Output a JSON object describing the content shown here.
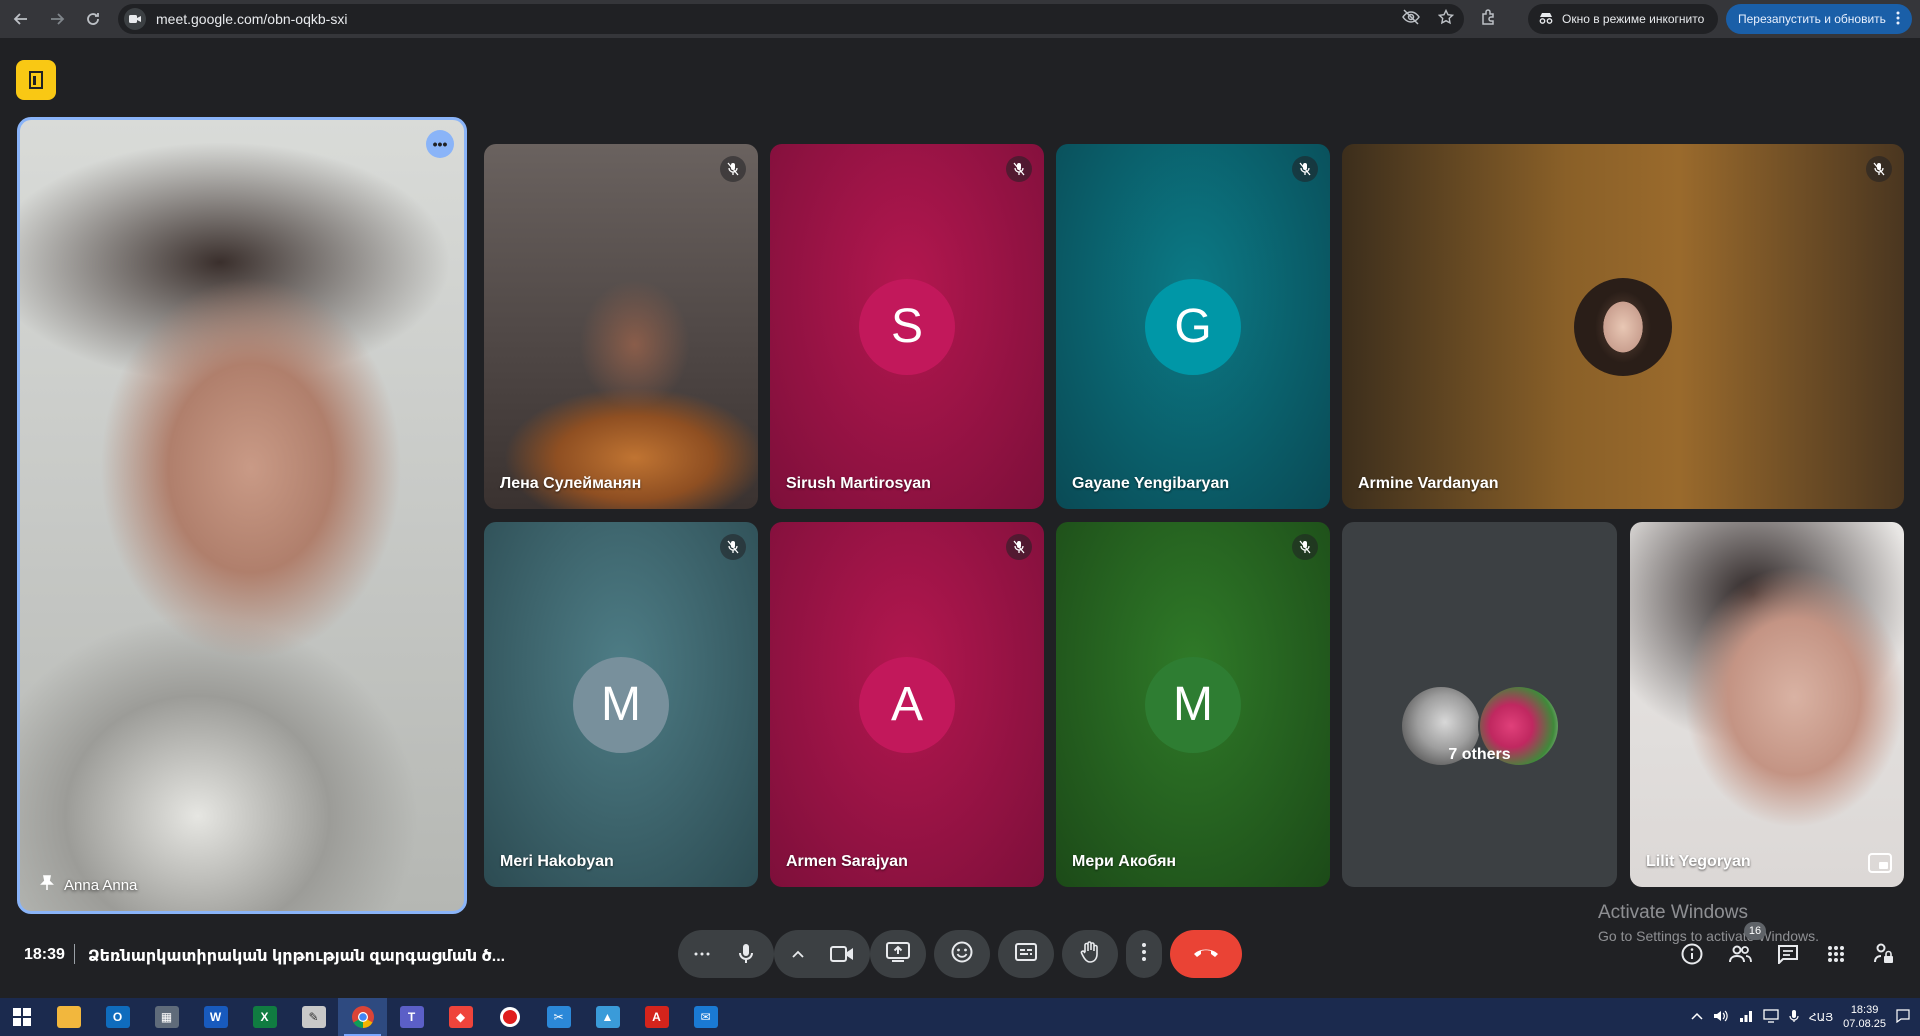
{
  "browser": {
    "url": "meet.google.com/obn-oqkb-sxi",
    "incognito_label": "Окно в режиме инкогнито",
    "relaunch_label": "Перезапустить и обновить"
  },
  "pinned": {
    "name": "Anna Anna"
  },
  "tiles": [
    {
      "name": "Лена Сулейманян",
      "muted": true
    },
    {
      "name": "Sirush Martirosyan",
      "initial": "S",
      "color": "#c2185b",
      "muted": true
    },
    {
      "name": "Gayane Yengibaryan",
      "initial": "G",
      "color": "#0097a7",
      "muted": true
    },
    {
      "name": "Armine Vardanyan",
      "muted": true
    },
    {
      "name": "Meri Hakobyan",
      "initial": "M",
      "color": "#78909c",
      "muted": true
    },
    {
      "name": "Armen Sarajyan",
      "initial": "A",
      "color": "#c2185b",
      "muted": true
    },
    {
      "name": "Мери Акобян",
      "initial": "M",
      "color": "#2e7d32",
      "muted": true
    },
    {
      "name": "7 others"
    },
    {
      "name": "Lilit Yegoryan"
    }
  ],
  "meeting": {
    "time": "18:39",
    "title": "Ձեռնարկատիրական կրթության զարգացման ծ..."
  },
  "watermark": {
    "line1": "Activate Windows",
    "line2": "Go to Settings to activate Windows."
  },
  "people_count": "16",
  "colors": {
    "end_call": "#ea4335",
    "pin_border": "#8ab4f8",
    "badge": "#f9c814",
    "relaunch": "#1a5fa8"
  },
  "taskbar": {
    "apps": [
      "file-explorer",
      "outlook",
      "calculator",
      "word",
      "excel",
      "paint",
      "chrome",
      "teams",
      "anydesk",
      "recorder",
      "snipping-tool",
      "photos",
      "acrobat",
      "mail"
    ],
    "lang": "ՀԱՅ",
    "time": "18:39",
    "date": "07.08.25"
  }
}
